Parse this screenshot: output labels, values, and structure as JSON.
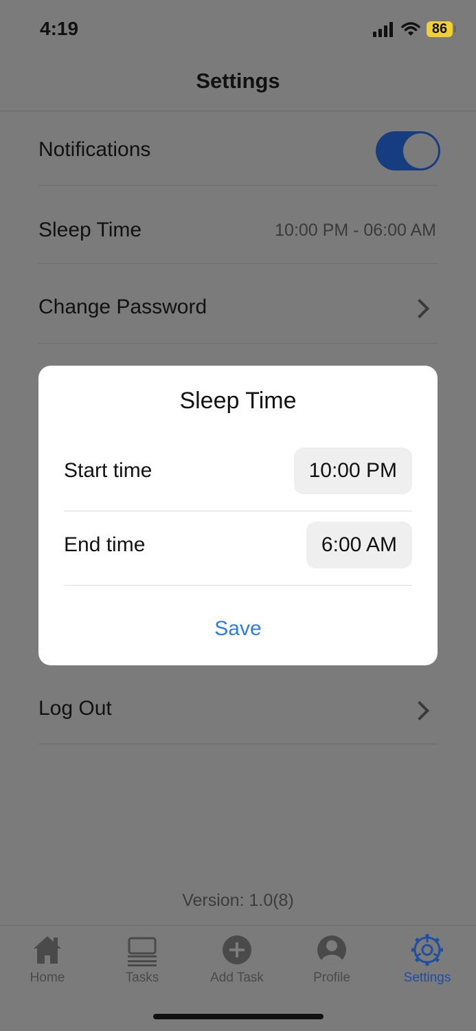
{
  "status_bar": {
    "time": "4:19",
    "battery": "86"
  },
  "header": {
    "title": "Settings"
  },
  "settings": {
    "notifications_label": "Notifications",
    "notifications_on": true,
    "sleep_time_label": "Sleep Time",
    "sleep_time_value": "10:00 PM - 06:00 AM",
    "change_password_label": "Change Password",
    "logout_label": "Log Out"
  },
  "modal": {
    "title": "Sleep Time",
    "start_label": "Start time",
    "start_value": "10:00 PM",
    "end_label": "End time",
    "end_value": "6:00 AM",
    "save_label": "Save"
  },
  "version": "Version: 1.0(8)",
  "tabs": [
    {
      "label": "Home",
      "icon": "home-icon"
    },
    {
      "label": "Tasks",
      "icon": "tasks-icon"
    },
    {
      "label": "Add Task",
      "icon": "add-task-icon"
    },
    {
      "label": "Profile",
      "icon": "profile-icon"
    },
    {
      "label": "Settings",
      "icon": "settings-icon"
    }
  ],
  "colors": {
    "accent": "#2f7ce0",
    "active_tab": "#1f4fa0",
    "toggle_on": "#163d7f"
  }
}
